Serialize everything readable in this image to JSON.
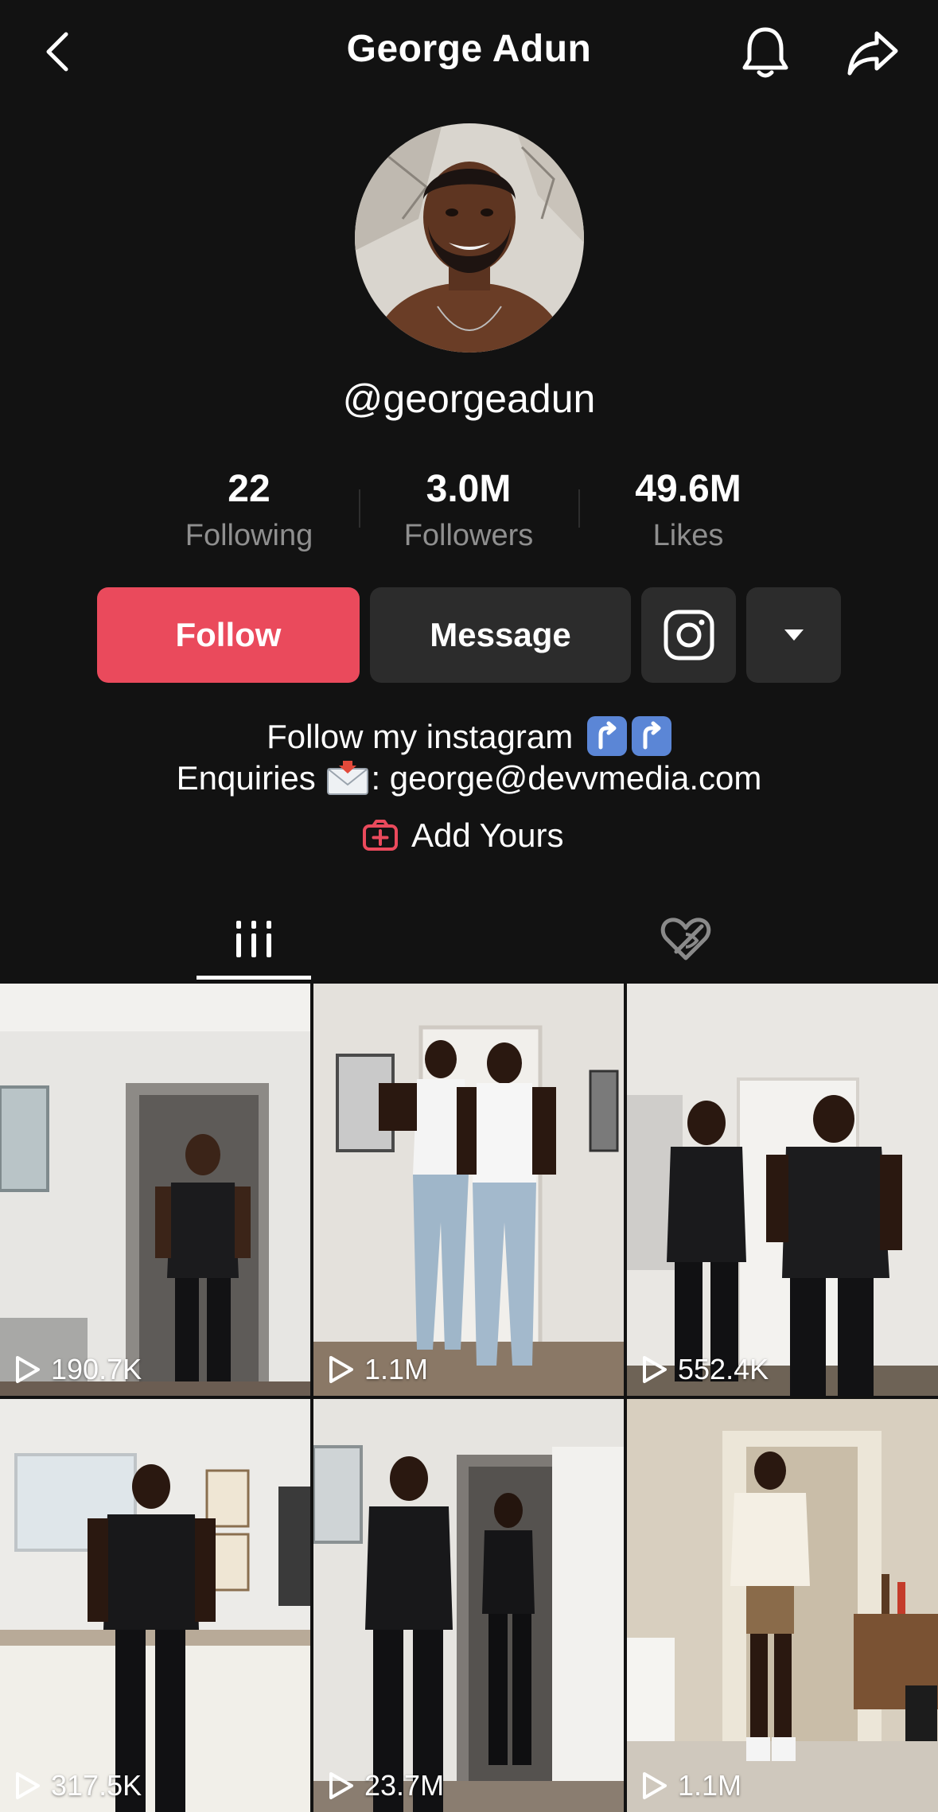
{
  "header": {
    "title": "George Adun",
    "back_icon": "chevron-left-icon",
    "bell_icon": "bell-icon",
    "share_icon": "share-arrow-icon"
  },
  "profile": {
    "handle": "@georgeadun",
    "stats": [
      {
        "value": "22",
        "label": "Following"
      },
      {
        "value": "3.0M",
        "label": "Followers"
      },
      {
        "value": "49.6M",
        "label": "Likes"
      }
    ]
  },
  "actions": {
    "follow_label": "Follow",
    "message_label": "Message",
    "instagram_icon": "instagram-icon",
    "more_icon": "caret-down-icon",
    "follow_color": "#ea4a5c"
  },
  "bio": {
    "line1": "Follow my instagram",
    "line2_prefix": "Enquiries",
    "line2_suffix": ": george@devvmedia.com",
    "add_yours": "Add Yours"
  },
  "tabs": [
    {
      "name": "videos",
      "icon": "grid-bars-icon",
      "active": true
    },
    {
      "name": "liked",
      "icon": "hidden-heart-icon",
      "active": false
    }
  ],
  "videos": [
    {
      "views": "190.7K"
    },
    {
      "views": "1.1M"
    },
    {
      "views": "552.4K"
    },
    {
      "views": "317.5K"
    },
    {
      "views": "23.7M"
    },
    {
      "views": "1.1M"
    }
  ]
}
